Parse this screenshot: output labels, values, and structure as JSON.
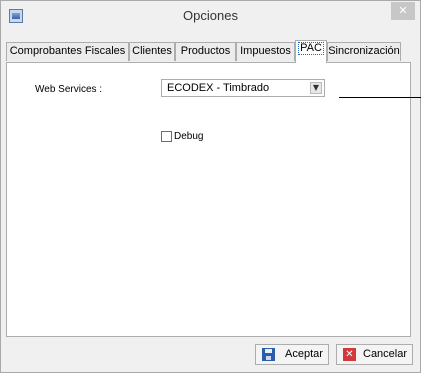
{
  "window": {
    "title": "Opciones",
    "close_glyph": "✕"
  },
  "tabs": [
    {
      "label": "Comprobantes Fiscales"
    },
    {
      "label": "Clientes"
    },
    {
      "label": "Productos"
    },
    {
      "label": "Impuestos"
    },
    {
      "label": "PAC",
      "active": true
    },
    {
      "label": "Sincronización"
    }
  ],
  "pac": {
    "web_services_label": "Web Services :",
    "web_services_value": "ECODEX - Timbrado",
    "debug_label": "Debug",
    "debug_checked": false
  },
  "buttons": {
    "accept": "Aceptar",
    "cancel": "Cancelar"
  },
  "icons": {
    "app": "app-icon",
    "save": "save-icon",
    "cancel": "cancel-icon",
    "dropdown": "chevron-down-icon"
  },
  "colors": {
    "tab_focus": "#1c63c4",
    "cancel_icon": "#d3383c",
    "save_icon": "#2b5ea8"
  }
}
